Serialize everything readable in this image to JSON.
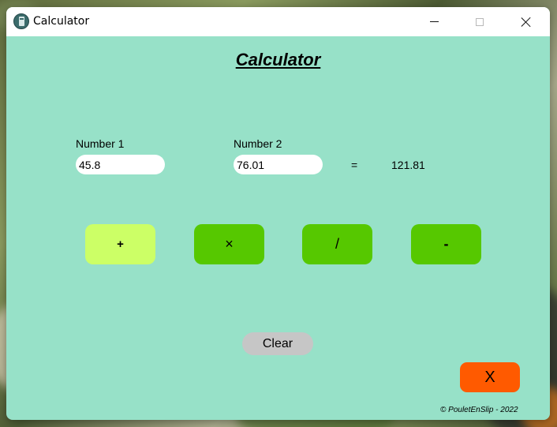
{
  "window": {
    "title": "Calculator",
    "icon": "calculator-icon",
    "controls": {
      "minimize": "minimize-icon",
      "maximize": "maximize-icon",
      "close": "close-icon"
    }
  },
  "main": {
    "heading": "Calculator",
    "number1_label": "Number 1",
    "number1_value": "45.8",
    "number2_label": "Number 2",
    "number2_value": "76.01",
    "equals": "=",
    "result": "121.81"
  },
  "operations": [
    {
      "label": "+",
      "color": "#ccff66"
    },
    {
      "label": "×",
      "color": "#56c800"
    },
    {
      "label": "/",
      "color": "#56c800"
    },
    {
      "label": "-",
      "color": "#56c800"
    }
  ],
  "actions": {
    "clear_label": "Clear",
    "exit_label": "X",
    "exit_color": "#ff5a00"
  },
  "footer": "© PouletEnSlip - 2022",
  "colors": {
    "window_background": "#97e1c8",
    "clear_button": "#c6c6c6"
  }
}
